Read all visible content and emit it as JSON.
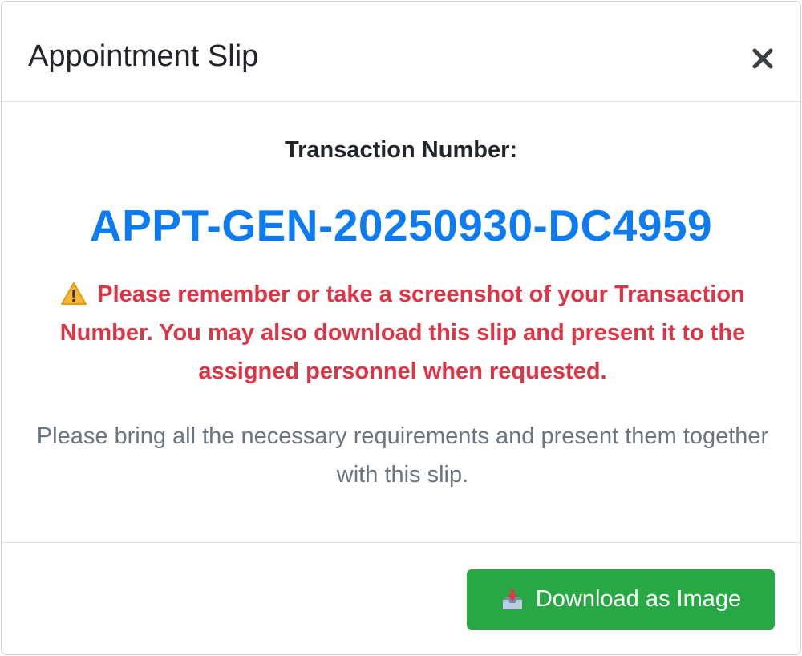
{
  "modal": {
    "title": "Appointment Slip",
    "close_icon": "close-icon"
  },
  "body": {
    "transaction_label": "Transaction Number:",
    "transaction_number": "APPT-GEN-20250930-DC4959",
    "warning_icon": "warning-icon",
    "warning_text": "Please remember or take a screenshot of your Transaction Number. You may also download this slip and present it to the assigned personnel when requested.",
    "note_text": "Please bring all the necessary requirements and present them together with this slip."
  },
  "footer": {
    "download_icon": "inbox-download-icon",
    "download_label": "Download as Image"
  },
  "colors": {
    "transaction_number": "#0d7bf2",
    "warning": "#dc3545",
    "note": "#6c757d",
    "download_button": "#28a745"
  }
}
